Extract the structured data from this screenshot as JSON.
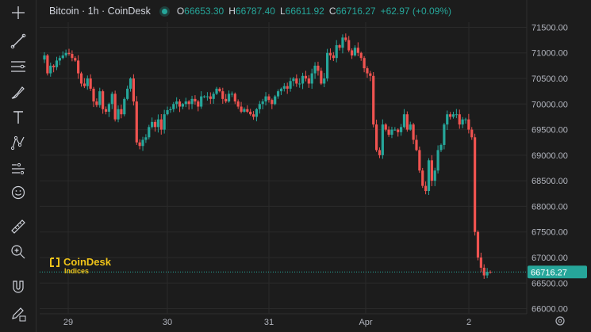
{
  "header": {
    "title": "Bitcoin · 1h · CoinDesk",
    "ohlc": [
      {
        "k": "O",
        "v": "66653.30"
      },
      {
        "k": "H",
        "v": "66787.40"
      },
      {
        "k": "L",
        "v": "66611.92"
      },
      {
        "k": "C",
        "v": "66716.27"
      }
    ],
    "change": "+62.97 (+0.09%)"
  },
  "watermark": {
    "name": "CoinDesk",
    "sub": "Indices"
  },
  "toolbar": {
    "tools": [
      "crosshair-icon",
      "trend-line-icon",
      "horizontal-lines-icon",
      "brush-icon",
      "text-icon",
      "pattern-icon",
      "forecast-icon",
      "emoji-icon",
      "ruler-icon",
      "zoom-in-icon",
      "magnet-icon",
      "pencil-lock-icon"
    ]
  },
  "colors": {
    "up": "#26a69a",
    "down": "#ef5350",
    "background": "#1c1c1c",
    "grid": "#2a2a2a",
    "axis_text": "#b2b5be",
    "last_price": "#26a69a"
  },
  "chart_data": {
    "type": "candlestick",
    "title": "Bitcoin · 1h · CoinDesk",
    "ylim": [
      65900,
      71600
    ],
    "y_ticks": [
      "71500.00",
      "71000.00",
      "70500.00",
      "70000.00",
      "69500.00",
      "69000.00",
      "68500.00",
      "68000.00",
      "67500.00",
      "67000.00",
      "66500.00",
      "66000.00"
    ],
    "x_ticks": [
      "29",
      "30",
      "31",
      "Apr",
      "2"
    ],
    "last_price": "66716.27",
    "grid": true,
    "close_path": [
      70950,
      70600,
      70750,
      70720,
      70850,
      70900,
      70950,
      71000,
      70980,
      70900,
      70850,
      70600,
      70400,
      70350,
      70500,
      70300,
      70050,
      69980,
      70250,
      69900,
      69850,
      70000,
      70200,
      69700,
      69900,
      69800,
      70100,
      70300,
      70500,
      70050,
      69250,
      69180,
      69300,
      69350,
      69550,
      69650,
      69550,
      69700,
      69500,
      69800,
      69880,
      69900,
      70000,
      70050,
      69950,
      70000,
      70050,
      70000,
      70100,
      70050,
      69950,
      70150,
      70150,
      70150,
      70100,
      70200,
      70300,
      70250,
      70100,
      70050,
      70200,
      70200,
      70050,
      69950,
      69850,
      69900,
      69850,
      69800,
      69750,
      69900,
      70000,
      70050,
      70150,
      70080,
      70000,
      70150,
      70250,
      70300,
      70350,
      70300,
      70450,
      70500,
      70400,
      70400,
      70550,
      70500,
      70400,
      70600,
      70750,
      70650,
      70400,
      70500,
      71000,
      70950,
      70900,
      71150,
      71100,
      71300,
      71250,
      71050,
      70950,
      71100,
      71000,
      70900,
      70700,
      70600,
      70550,
      69600,
      69100,
      69000,
      69600,
      69500,
      69400,
      69500,
      69500,
      69450,
      69550,
      69800,
      69500,
      69600,
      69300,
      69100,
      68700,
      68400,
      68300,
      68900,
      68500,
      68700,
      69100,
      69200,
      69600,
      69800,
      69750,
      69800,
      69800,
      69600,
      69700,
      69700,
      69500,
      69350,
      67500,
      67000,
      66800,
      66650,
      66720,
      66716
    ],
    "series": [
      {
        "values": []
      }
    ]
  }
}
